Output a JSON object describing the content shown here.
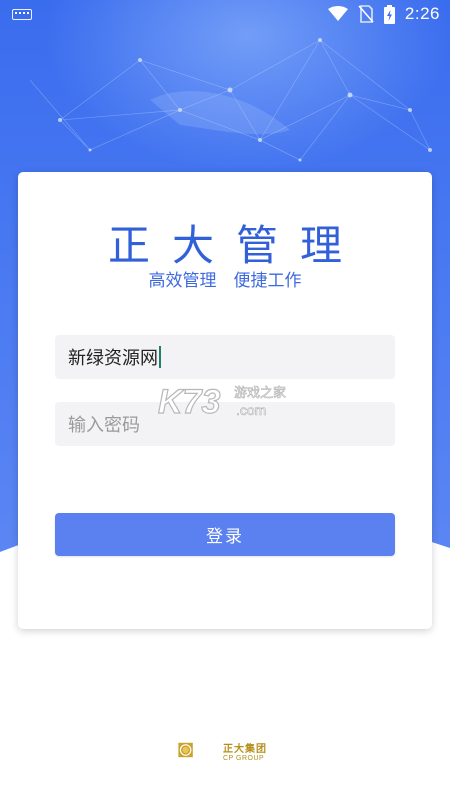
{
  "status_bar": {
    "time": "2:26",
    "icons": [
      "keyboard-icon",
      "wifi-icon",
      "no-sim-icon",
      "battery-charging-icon"
    ]
  },
  "login": {
    "title": "正大管理",
    "slogan": "高效管理　便捷工作",
    "username_value": "新绿资源网",
    "password_placeholder": "输入密码",
    "login_button": "登录"
  },
  "watermark": {
    "main": "K73",
    "cn": "游戏之家",
    "domain": ".com"
  },
  "footer": {
    "brand_cn": "正大集团",
    "brand_en": "CP GROUP"
  },
  "colors": {
    "accent": "#3160d8",
    "button": "#5b80ef",
    "hero_top": "#2f63e8",
    "brand_gold": "#b58e1b"
  }
}
